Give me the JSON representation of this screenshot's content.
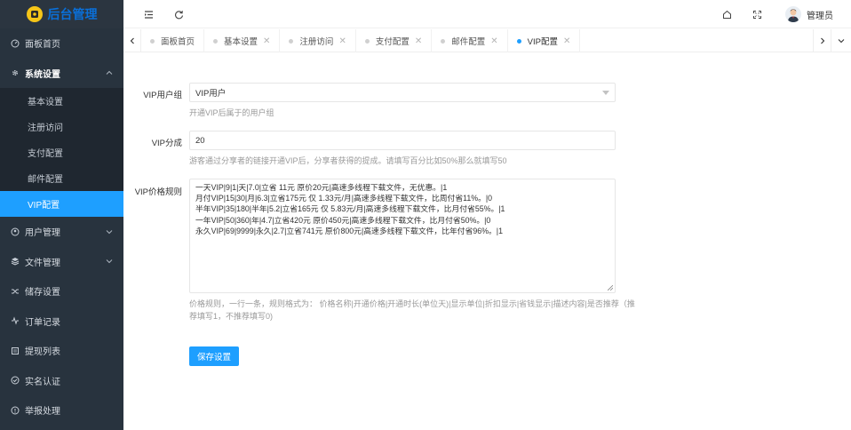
{
  "app": {
    "title": "后台管理"
  },
  "sidebar": {
    "items": [
      {
        "label": "面板首页",
        "icon": "dashboard-icon"
      },
      {
        "label": "系统设置",
        "icon": "gear-icon",
        "open": true,
        "children": [
          "基本设置",
          "注册访问",
          "支付配置",
          "邮件配置",
          "VIP配置"
        ]
      },
      {
        "label": "用户管理",
        "icon": "user-icon"
      },
      {
        "label": "文件管理",
        "icon": "layers-icon"
      },
      {
        "label": "储存设置",
        "icon": "shuffle-icon"
      },
      {
        "label": "订单记录",
        "icon": "activity-icon"
      },
      {
        "label": "提现列表",
        "icon": "list-icon"
      },
      {
        "label": "实名认证",
        "icon": "shield-check-icon"
      },
      {
        "label": "举报处理",
        "icon": "alert-circle-icon"
      }
    ]
  },
  "header": {
    "user_name": "管理员"
  },
  "tabs": [
    {
      "label": "面板首页",
      "closable": false
    },
    {
      "label": "基本设置",
      "closable": true
    },
    {
      "label": "注册访问",
      "closable": true
    },
    {
      "label": "支付配置",
      "closable": true
    },
    {
      "label": "邮件配置",
      "closable": true
    },
    {
      "label": "VIP配置",
      "closable": true,
      "active": true
    }
  ],
  "form": {
    "vip_group": {
      "label": "VIP用户组",
      "value": "VIP用户",
      "hint": "开通VIP后属于的用户组"
    },
    "vip_share": {
      "label": "VIP分成",
      "value": "20",
      "hint": "游客通过分享者的链接开通VIP后，分享者获得的提成。请填写百分比如50%那么就填写50"
    },
    "vip_rules": {
      "label": "VIP价格规则",
      "lines": [
        "一天VIP|9|1|天|7.0|立省 11元 原价20元|高速多线程下载文件，无优惠。|1",
        "月付VIP|15|30|月|6.3|立省175元 仅 1.33元/月|高速多线程下载文件，比周付省11%。|0",
        "半年VIP|35|180|半年|5.2|立省165元 仅 5.83元/月|高速多线程下载文件，比月付省55%。|1",
        "一年VIP|50|360|年|4.7|立省420元 原价450元|高速多线程下载文件，比月付省50%。|0",
        "永久VIP|69|9999|永久|2.7|立省741元 原价800元|高速多线程下载文件，比年付省96%。|1"
      ],
      "hint_line1": "价格规则，一行一条，规则格式为：  价格名称|开通价格|开通时长(单位天)|显示单位|折扣显示|省钱显示|描述内容|是否推荐（推",
      "hint_line2": "荐填写1，不推荐填写0)"
    },
    "save_label": "保存设置"
  },
  "colors": {
    "accent": "#1e9fff",
    "sidebar_bg": "#28333e",
    "logo_text": "#0a6fd8"
  }
}
